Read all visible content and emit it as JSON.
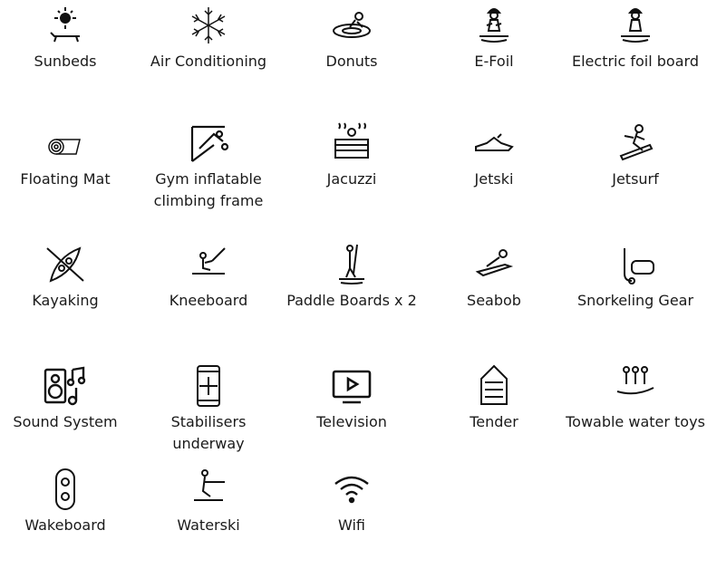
{
  "amenities": [
    {
      "label": "Sunbeds",
      "icon": "sunbed-icon"
    },
    {
      "label": "Air Conditioning",
      "icon": "snowflake-icon"
    },
    {
      "label": "Donuts",
      "icon": "donut-tube-icon"
    },
    {
      "label": "E-Foil",
      "icon": "efoil-icon"
    },
    {
      "label": "Electric foil board",
      "icon": "electric-foil-board-icon"
    },
    {
      "label": "Floating Mat",
      "icon": "floating-mat-icon"
    },
    {
      "label": "Gym inflatable climbing frame",
      "icon": "climbing-frame-icon"
    },
    {
      "label": "Jacuzzi",
      "icon": "jacuzzi-icon"
    },
    {
      "label": "Jetski",
      "icon": "jetski-icon"
    },
    {
      "label": "Jetsurf",
      "icon": "jetsurf-icon"
    },
    {
      "label": "Kayaking",
      "icon": "kayak-icon"
    },
    {
      "label": "Kneeboard",
      "icon": "kneeboard-icon"
    },
    {
      "label": "Paddle Boards x 2",
      "icon": "paddle-board-icon"
    },
    {
      "label": "Seabob",
      "icon": "seabob-icon"
    },
    {
      "label": "Snorkeling Gear",
      "icon": "snorkel-icon"
    },
    {
      "label": "Sound System",
      "icon": "speaker-icon"
    },
    {
      "label": "Stabilisers underway",
      "icon": "stabiliser-phone-icon"
    },
    {
      "label": "Television",
      "icon": "television-icon"
    },
    {
      "label": "Tender",
      "icon": "tender-boat-icon"
    },
    {
      "label": "Towable water toys",
      "icon": "towable-banana-icon"
    },
    {
      "label": "Wakeboard",
      "icon": "wakeboard-icon"
    },
    {
      "label": "Waterski",
      "icon": "waterski-icon"
    },
    {
      "label": "Wifi",
      "icon": "wifi-icon"
    }
  ]
}
